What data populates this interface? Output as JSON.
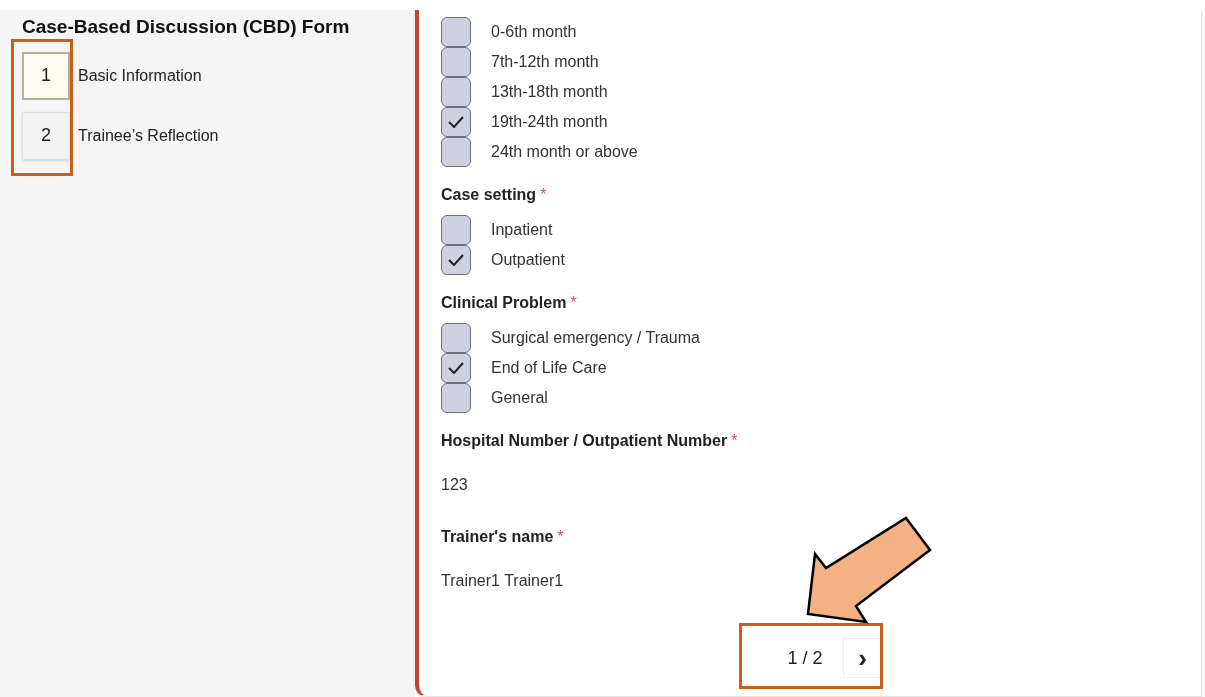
{
  "sidebar": {
    "title": "Case-Based Discussion (CBD) Form",
    "steps": [
      {
        "number": "1",
        "label": "Basic Information",
        "selected": true
      },
      {
        "number": "2",
        "label": "Trainee’s Reflection",
        "selected": false
      }
    ]
  },
  "form": {
    "sections": [
      {
        "kind": "checkboxes",
        "options": [
          {
            "label": "0-6th month",
            "checked": false
          },
          {
            "label": "7th-12th month",
            "checked": false
          },
          {
            "label": "13th-18th month",
            "checked": false
          },
          {
            "label": "19th-24th month",
            "checked": true
          },
          {
            "label": "24th month or above",
            "checked": false
          }
        ]
      },
      {
        "kind": "checkboxes",
        "label": "Case setting",
        "required": "*",
        "options": [
          {
            "label": "Inpatient",
            "checked": false
          },
          {
            "label": "Outpatient",
            "checked": true
          }
        ]
      },
      {
        "kind": "checkboxes",
        "label": "Clinical Problem",
        "required": "*",
        "options": [
          {
            "label": "Surgical emergency / Trauma",
            "checked": false
          },
          {
            "label": "End of Life Care",
            "checked": true
          },
          {
            "label": "General",
            "checked": false
          }
        ]
      },
      {
        "kind": "value",
        "label": "Hospital Number / Outpatient Number",
        "required": "*",
        "value": "123"
      },
      {
        "kind": "value",
        "label": "Trainer's name",
        "required": "*",
        "value": "Trainer1 Trainer1"
      }
    ]
  },
  "pagination": {
    "page": "1 / 2",
    "next": "›"
  }
}
